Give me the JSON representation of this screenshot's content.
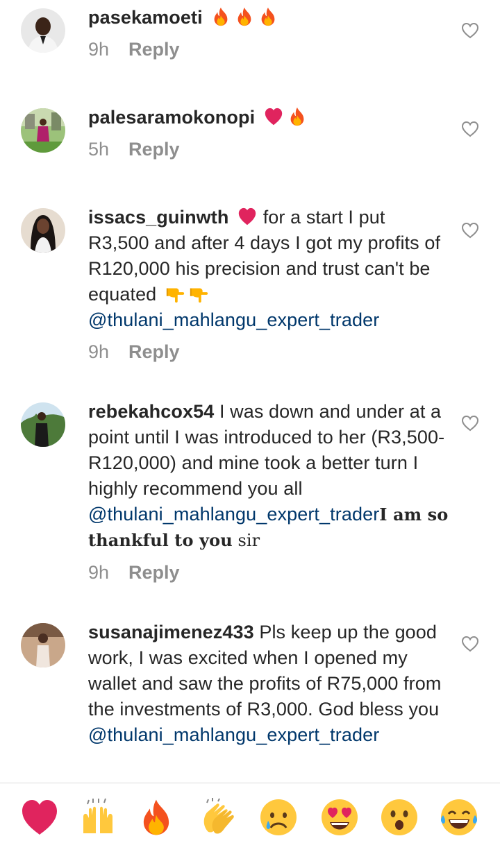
{
  "comments": [
    {
      "username": "pasekamoeti",
      "time": "9h",
      "reply_label": "Reply",
      "emojis": [
        "fire-icon",
        "fire-icon",
        "fire-icon"
      ]
    },
    {
      "username": "palesaramokonopi",
      "time": "5h",
      "reply_label": "Reply",
      "emojis": [
        "heart-icon",
        "fire-icon"
      ]
    },
    {
      "username": "issacs_guinwth",
      "text_1": "for a start I put R3,500 and after 4 days I got my profits of R120,000 his precision and trust can't be equated",
      "mention": "@thulani_mahlangu_expert_trader",
      "time": "9h",
      "reply_label": "Reply",
      "emojis": [
        "heart-icon",
        "pointing-down-icon",
        "pointing-down-icon"
      ]
    },
    {
      "username": "rebekahcox54",
      "text_1": "I was down and under at a point until I was introduced to her (R3,500-R120,000) and mine took a better turn I highly recommend you all",
      "mention": "@thulani_mahlangu_expert_trader",
      "text_bold": "I am so thankful to you",
      "text_end": " sir",
      "time": "9h",
      "reply_label": "Reply"
    },
    {
      "username": "susanajimenez433",
      "text_1": "Pls keep up the good work, I was excited when I opened my wallet and saw the profits of R75,000 from the investments of R3,000. God bless you",
      "mention": "@thulani_mahlangu_expert_trader"
    }
  ],
  "reaction_bar": [
    "red-heart-icon",
    "raised-hands-icon",
    "fire-icon",
    "clapping-hands-icon",
    "sad-face-icon",
    "heart-eyes-icon",
    "surprised-face-icon",
    "tears-of-joy-icon"
  ],
  "colors": {
    "text": "#262626",
    "meta": "#8e8e8e",
    "mention": "#00376b",
    "heart": "#e0245e",
    "divider": "#dbdbdb"
  }
}
